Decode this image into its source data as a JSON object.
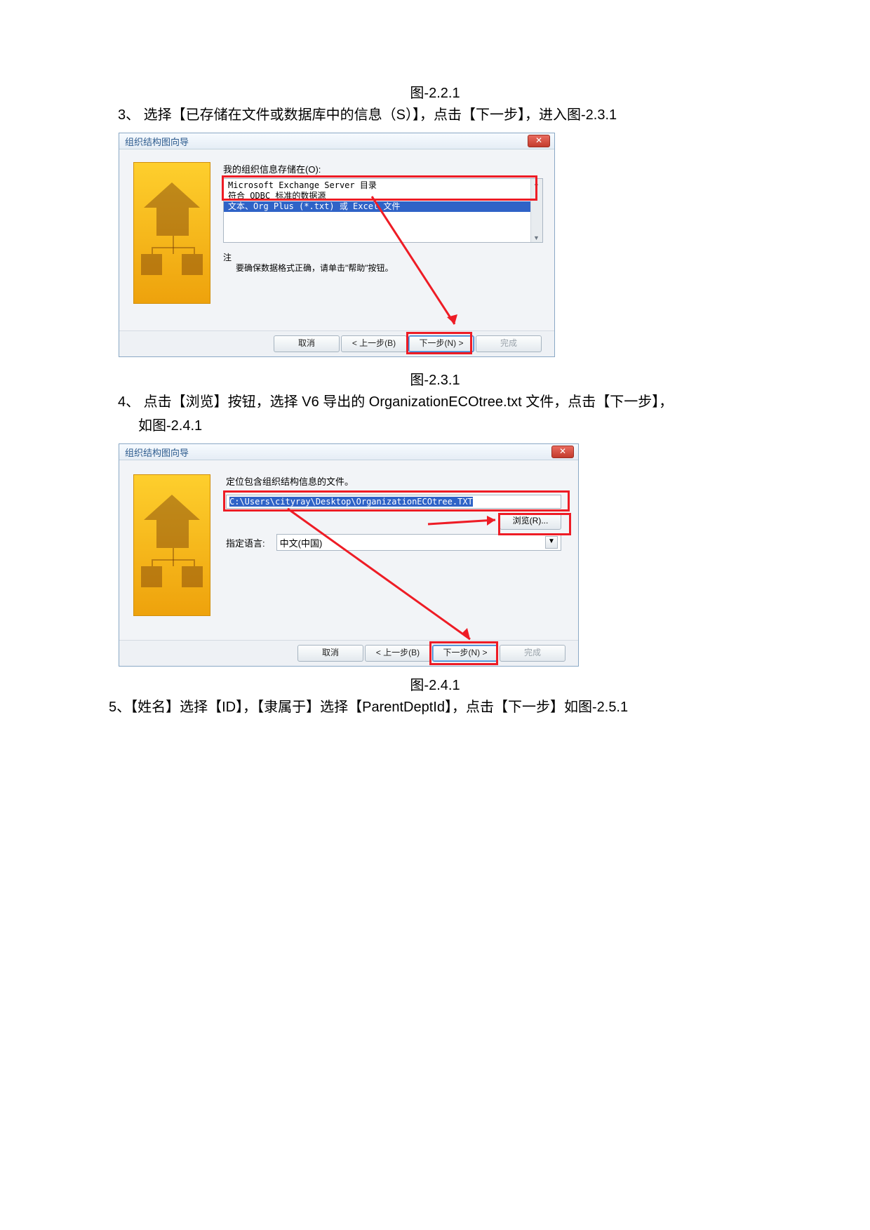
{
  "captions": {
    "c221": "图-2.2.1",
    "c231": "图-2.3.1",
    "c241": "图-2.4.1"
  },
  "instructions": {
    "s3": "3、 选择【已存储在文件或数据库中的信息（S）】，点击【下一步】，进入图-2.3.1",
    "s4a": "4、 点击【浏览】按钮，选择 V6 导出的 OrganizationECOtree.txt 文件，点击【下一步】，",
    "s4b": "如图-2.4.1",
    "s5": "5、【姓名】选择【ID】，【隶属于】选择【ParentDeptId】，点击【下一步】如图-2.5.1"
  },
  "dialog1": {
    "title": "组织结构图向导",
    "label": "我的组织信息存储在(O):",
    "list": {
      "r0": "Microsoft Exchange Server 目录",
      "r1": "符合 ODBC 标准的数据源",
      "r2": "文本、Org Plus (*.txt) 或 Excel 文件"
    },
    "note_key": "注",
    "note_body": "要确保数据格式正确，请单击\"帮助\"按钮。",
    "buttons": {
      "cancel": "取消",
      "back": "< 上一步(B)",
      "next": "下一步(N) >",
      "finish": "完成"
    },
    "help": "?"
  },
  "dialog2": {
    "title": "组织结构图向导",
    "label": "定位包含组织结构信息的文件。",
    "path": "C:\\Users\\cityray\\Desktop\\OrganizationECOtree.TXT",
    "browse": "浏览(R)...",
    "langlabel": "指定语言:",
    "langvalue": "中文(中国)",
    "buttons": {
      "cancel": "取消",
      "back": "< 上一步(B)",
      "next": "下一步(N) >",
      "finish": "完成"
    }
  }
}
